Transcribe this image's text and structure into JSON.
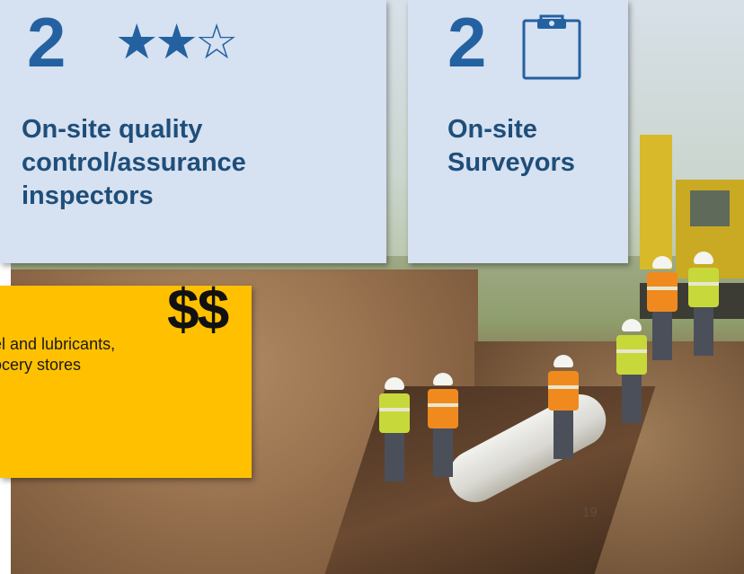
{
  "inspectors_card": {
    "count": "2",
    "rating_stars": "★★☆",
    "rating_filled": 2,
    "rating_max": 3,
    "icon": "star-rating-icon",
    "label_lines": [
      "On-site quality",
      "control/assurance",
      "inspectors"
    ]
  },
  "surveyors_card": {
    "count": "2",
    "icon": "clipboard-icon",
    "label_lines": [
      "On-site",
      "Surveyors"
    ]
  },
  "cost_callout": {
    "symbol": "$$",
    "lines": [
      "el and lubricants,",
      "ocery stores"
    ]
  },
  "photo": {
    "page_number": "19"
  },
  "colors": {
    "card_background": "#d6e1f1",
    "accent_blue": "#2461a1",
    "label_blue": "#1f4e79",
    "callout_yellow": "#ffc000"
  }
}
